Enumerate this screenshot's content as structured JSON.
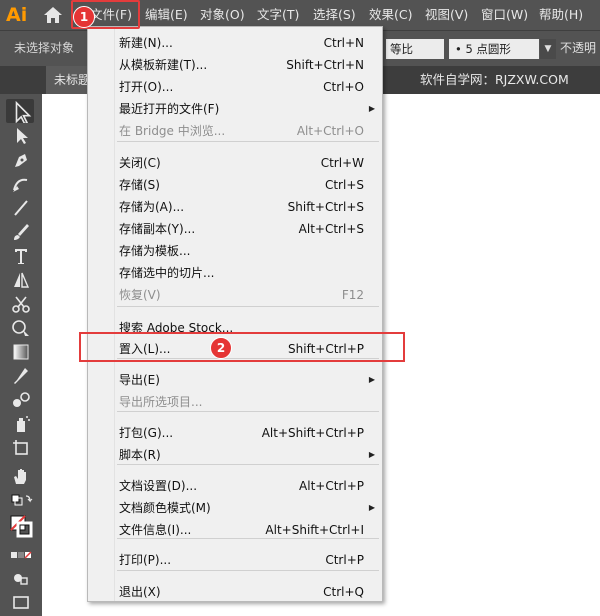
{
  "app": {
    "logo_text": "Ai"
  },
  "menubar": {
    "items": [
      "文件(F)",
      "编辑(E)",
      "对象(O)",
      "文字(T)",
      "选择(S)",
      "效果(C)",
      "视图(V)",
      "窗口(W)",
      "帮助(H)"
    ]
  },
  "controlbar": {
    "no_selection": "未选择对象",
    "proportion": "等比",
    "brush": "• 5 点圆形",
    "opacity": "不透明"
  },
  "tabbar": {
    "doc_title": "未标题",
    "watermark": "软件自学网：RJZXW.COM"
  },
  "file_menu": {
    "items": [
      {
        "label": "新建(N)...",
        "shortcut": "Ctrl+N"
      },
      {
        "label": "从模板新建(T)...",
        "shortcut": "Shift+Ctrl+N"
      },
      {
        "label": "打开(O)...",
        "shortcut": "Ctrl+O"
      },
      {
        "label": "最近打开的文件(F)",
        "shortcut": "",
        "submenu": "▶"
      },
      {
        "label": "在 Bridge 中浏览...",
        "shortcut": "Alt+Ctrl+O",
        "disabled": true
      },
      {
        "label": "关闭(C)",
        "shortcut": "Ctrl+W"
      },
      {
        "label": "存储(S)",
        "shortcut": "Ctrl+S"
      },
      {
        "label": "存储为(A)...",
        "shortcut": "Shift+Ctrl+S"
      },
      {
        "label": "存储副本(Y)...",
        "shortcut": "Alt+Ctrl+S"
      },
      {
        "label": "存储为模板...",
        "shortcut": ""
      },
      {
        "label": "存储选中的切片...",
        "shortcut": ""
      },
      {
        "label": "恢复(V)",
        "shortcut": "F12",
        "disabled": true
      },
      {
        "label": "搜索 Adobe Stock...",
        "shortcut": ""
      },
      {
        "label": "置入(L)...",
        "shortcut": "Shift+Ctrl+P"
      },
      {
        "label": "导出(E)",
        "shortcut": "",
        "submenu": "▶"
      },
      {
        "label": "导出所选项目...",
        "shortcut": "",
        "disabled": true
      },
      {
        "label": "打包(G)...",
        "shortcut": "Alt+Shift+Ctrl+P"
      },
      {
        "label": "脚本(R)",
        "shortcut": "",
        "submenu": "▶"
      },
      {
        "label": "文档设置(D)...",
        "shortcut": "Alt+Ctrl+P"
      },
      {
        "label": "文档颜色模式(M)",
        "shortcut": "",
        "submenu": "▶"
      },
      {
        "label": "文件信息(I)...",
        "shortcut": "Alt+Shift+Ctrl+I"
      },
      {
        "label": "打印(P)...",
        "shortcut": "Ctrl+P"
      },
      {
        "label": "退出(X)",
        "shortcut": "Ctrl+Q"
      }
    ]
  },
  "annotations": {
    "badge1": "1",
    "badge2": "2"
  },
  "colors": {
    "annotation_red": "#e33c3c",
    "logo_orange": "#ff9a00",
    "chrome": "#535353"
  },
  "icons": [
    "home-icon",
    "selection-tool-icon",
    "direct-selection-icon",
    "pen-icon",
    "curvature-icon",
    "line-icon",
    "paintbrush-icon",
    "type-icon",
    "reflect-icon",
    "scissors-icon",
    "shape-builder-icon",
    "gradient-icon",
    "eyedropper-icon",
    "blend-icon",
    "symbol-sprayer-icon",
    "artboard-icon",
    "hand-icon"
  ]
}
